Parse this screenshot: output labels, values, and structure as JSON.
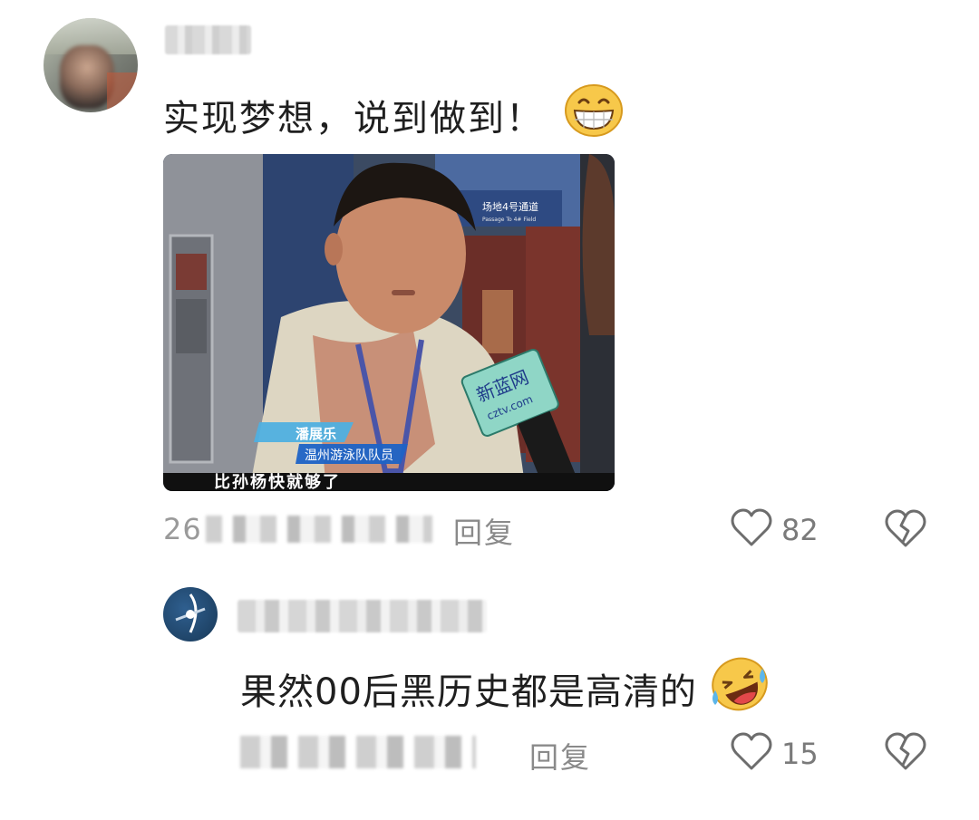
{
  "comment": {
    "text": "实现梦想，说到做到！",
    "emoji_icon": "grinning-face-icon",
    "media": {
      "channel_logo": "新蓝网",
      "logo_sub": "cztv.com",
      "sign_top": "场地4号通道",
      "sign_sub": "Passage To 4# Field",
      "lower_third_name": "潘展乐",
      "lower_third_role": "温州游泳队队员",
      "caption": "比孙杨快就够了"
    },
    "time_prefix": "26",
    "reply_label": "回复",
    "like_count": "82"
  },
  "reply": {
    "username": "航天飞行城万局",
    "text": "果然00后黑历史都是高清的",
    "emoji_icon": "rolling-on-floor-laughing-icon",
    "reply_label": "回复",
    "like_count": "15"
  },
  "colors": {
    "text": "#1f1f1f",
    "meta": "#8a8a8a",
    "icon": "#6d6d6d"
  }
}
